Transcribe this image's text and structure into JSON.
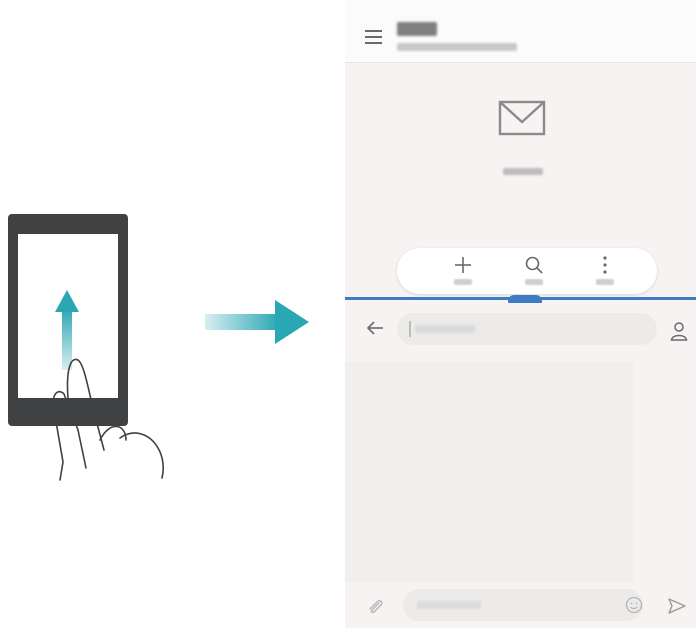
{
  "illustration": {
    "phone_icon": "phone-outline",
    "gesture_icon": "swipe-up-hand",
    "transition_icon": "right-arrow"
  },
  "colors": {
    "accent": "#3d7bc2",
    "arrow_start": "#d7eef0",
    "arrow_end": "#2aa7b4",
    "phone_body": "#3f4143",
    "screen_bg": "#f6f3f2"
  },
  "top_app": {
    "menu_icon": "hamburger-menu-icon",
    "account_name": "",
    "account_email": "",
    "empty_state_icon": "envelope-icon",
    "empty_state_text": "",
    "toolbar": [
      {
        "icon": "plus-icon",
        "label": ""
      },
      {
        "icon": "search-icon",
        "label": ""
      },
      {
        "icon": "more-vertical-icon",
        "label": ""
      }
    ]
  },
  "split_divider": {
    "handle_icon": "drag-handle-dots"
  },
  "bottom_app": {
    "back_icon": "back-arrow-icon",
    "recipient_value": "",
    "contact_icon": "person-icon",
    "attach_icon": "paperclip-icon",
    "compose_placeholder": "",
    "emoji_icon": "smiley-icon",
    "send_icon": "send-icon"
  }
}
